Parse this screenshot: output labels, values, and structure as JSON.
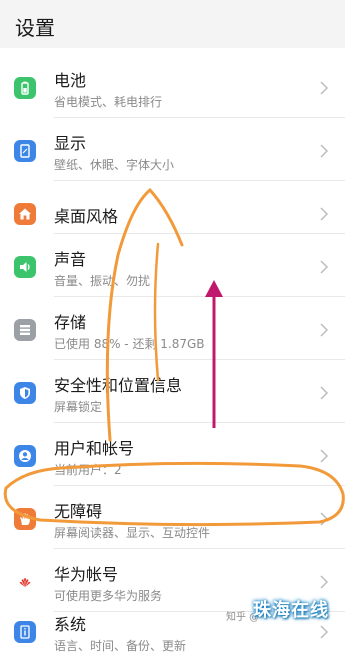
{
  "header": {
    "title": "设置"
  },
  "top_cutoff_sub": "------------",
  "rows": [
    {
      "title": "电池",
      "sub": "省电模式、耗电排行",
      "icon": "battery-icon",
      "color": "#3cc46c"
    },
    {
      "title": "显示",
      "sub": "壁纸、休眠、字体大小",
      "icon": "display-icon",
      "color": "#3d86e8"
    },
    {
      "title": "桌面风格",
      "sub": "",
      "icon": "home-icon",
      "color": "#f07b38"
    },
    {
      "title": "声音",
      "sub": "音量、振动、勿扰",
      "icon": "sound-icon",
      "color": "#3cc46c"
    },
    {
      "title": "存储",
      "sub": "已使用 88% - 还剩 1.87GB",
      "icon": "storage-icon",
      "color": "#9aa0a6"
    },
    {
      "title": "安全性和位置信息",
      "sub": "屏幕锁定",
      "icon": "shield-icon",
      "color": "#3d86e8"
    },
    {
      "title": "用户和帐号",
      "sub": "当前用户：2",
      "icon": "user-icon",
      "color": "#3d86e8"
    },
    {
      "title": "无障碍",
      "sub": "屏幕阅读器、显示、互动控件",
      "icon": "hand-icon",
      "color": "#f07b38"
    },
    {
      "title": "华为帐号",
      "sub": "可使用更多华为服务",
      "icon": "huawei-icon",
      "color": "#e5352b"
    },
    {
      "title": "系统",
      "sub": "语言、时间、备份、更新",
      "icon": "info-icon",
      "color": "#3d86e8"
    }
  ],
  "watermark": {
    "text": "知乎 @",
    "logo": "珠海在线"
  },
  "colors": {
    "annotation": "#f29a3a",
    "arrow": "#c0186c"
  }
}
